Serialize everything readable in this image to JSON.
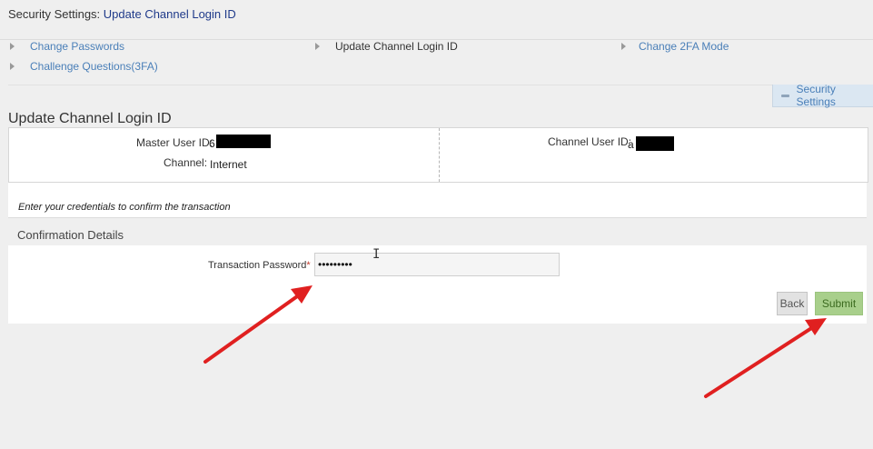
{
  "header": {
    "section": "Security Settings:",
    "current": "Update Channel Login ID"
  },
  "nav": {
    "items": [
      {
        "label": "Change Passwords"
      },
      {
        "label": "Update Channel Login ID"
      },
      {
        "label": "Change 2FA Mode"
      },
      {
        "label": "Challenge Questions(3FA)"
      }
    ]
  },
  "security_tab": {
    "label": "Security Settings"
  },
  "page_title": "Update Channel Login ID",
  "details": {
    "master_user_id_label": "Master User ID:",
    "master_user_id_value": "6",
    "channel_label": "Channel:",
    "channel_value": "Internet",
    "channel_user_id_label": "Channel User ID:",
    "channel_user_id_value": "a"
  },
  "credentials_note": "Enter your credentials to confirm the transaction",
  "confirmation": {
    "heading": "Confirmation Details",
    "password_label": "Transaction Password",
    "required_mark": "*",
    "password_value": "•••••••••",
    "text_cursor": "I"
  },
  "buttons": {
    "back": "Back",
    "submit": "Submit"
  },
  "colors": {
    "link": "#4a7fb8",
    "submit_bg": "#a8cf8b",
    "annotation_arrow": "#e02020"
  },
  "icons": [
    "triangle-right-icon",
    "minus-icon",
    "text-cursor-icon",
    "arrow-annotation"
  ]
}
